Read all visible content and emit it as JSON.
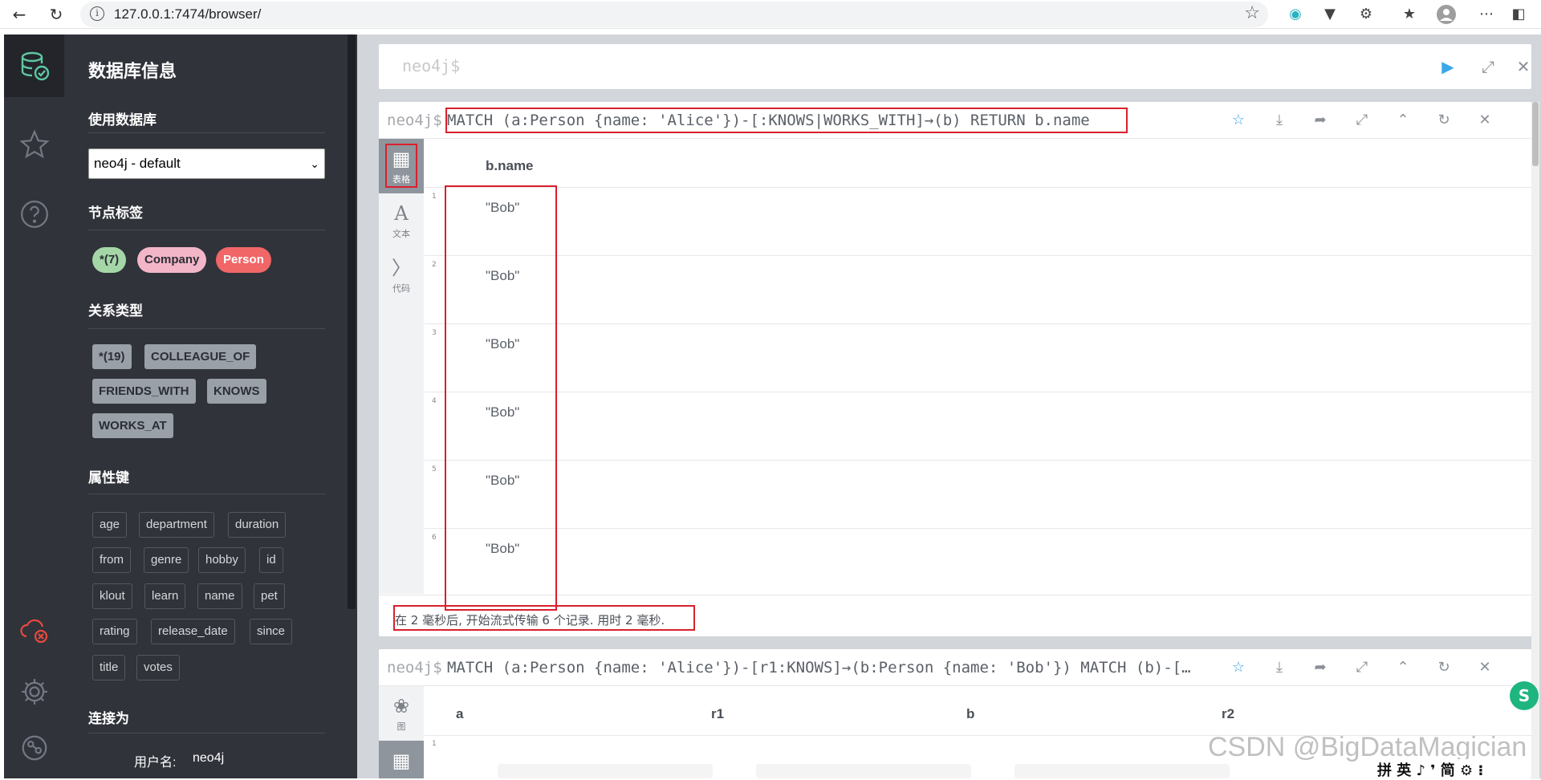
{
  "browser": {
    "url": "127.0.0.1:7474/browser/"
  },
  "sidebar": {
    "title": "数据库信息",
    "use_database_label": "使用数据库",
    "database_selected": "neo4j - default",
    "node_labels_title": "节点标签",
    "node_labels": [
      "*(7)",
      "Company",
      "Person"
    ],
    "relationship_types_title": "关系类型",
    "relationship_types": [
      "*(19)",
      "COLLEAGUE_OF",
      "FRIENDS_WITH",
      "KNOWS",
      "WORKS_AT"
    ],
    "property_keys_title": "属性键",
    "property_keys": [
      "age",
      "department",
      "duration",
      "from",
      "genre",
      "hobby",
      "id",
      "klout",
      "learn",
      "name",
      "pet",
      "rating",
      "release_date",
      "since",
      "title",
      "votes"
    ],
    "connected_as_title": "连接为",
    "username_label": "用户名:",
    "username_value": "neo4j"
  },
  "editor": {
    "prompt": "neo4j$"
  },
  "frame1": {
    "prompt": "neo4j$",
    "query": "MATCH (a:Person {name: 'Alice'})-[:KNOWS|WORKS_WITH]→(b) RETURN b.name",
    "views": [
      "表格",
      "文本",
      "代码"
    ],
    "column": "b.name",
    "row_numbers": [
      "1",
      "2",
      "3",
      "4",
      "5",
      "6"
    ],
    "rows": [
      "\"Bob\"",
      "\"Bob\"",
      "\"Bob\"",
      "\"Bob\"",
      "\"Bob\"",
      "\"Bob\""
    ],
    "status": "在 2 毫秒后, 开始流式传输 6 个记录. 用时 2 毫秒."
  },
  "frame2": {
    "prompt": "neo4j$",
    "query": "MATCH (a:Person {name: 'Alice'})-[r1:KNOWS]→(b:Person {name: 'Bob'}) MATCH (b)-[…",
    "views": [
      "图"
    ],
    "columns": [
      "a",
      "r1",
      "b",
      "r2"
    ],
    "row_numbers": [
      "1"
    ]
  },
  "overlay": {
    "watermark": "CSDN @BigDataMagician",
    "ime": "拼 英 ♪ ❜ 简 ⚙ ⁝"
  },
  "colors": {
    "sidebar_bg": "#30333a",
    "label_all": "#a5d6a7",
    "label_company": "#f3b5c8",
    "label_person": "#f16667",
    "highlight": "#d9202d",
    "run": "#3aa7e8"
  }
}
